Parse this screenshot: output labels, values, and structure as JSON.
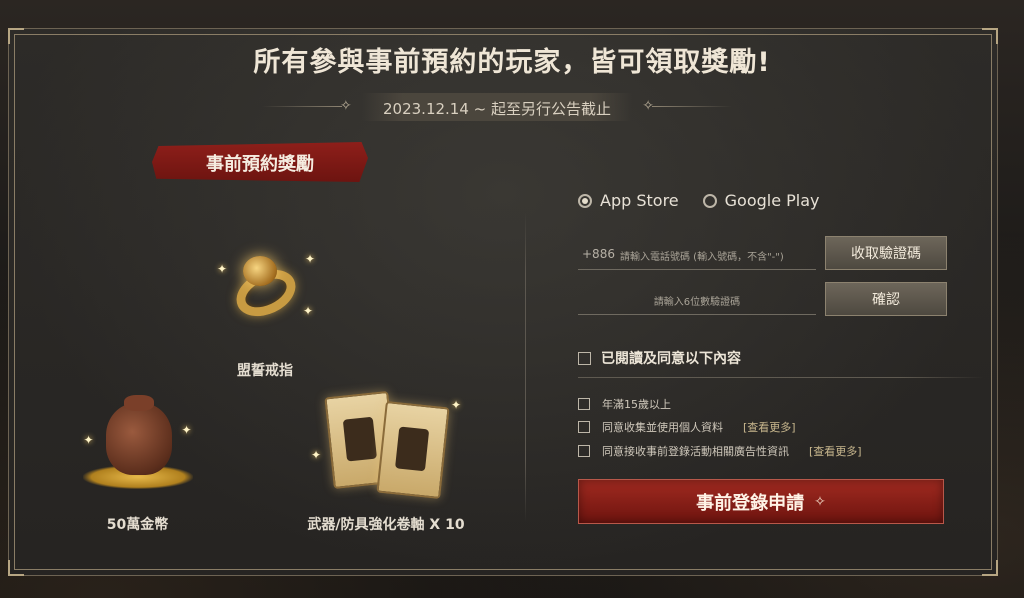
{
  "headline": "所有參與事前預約的玩家，皆可領取獎勵!",
  "period": "2023.12.14 ~ 起至另行公告截止",
  "rewards_title": "事前預約獎勵",
  "rewards": [
    {
      "name": "盟誓戒指",
      "icon": "ring-icon"
    },
    {
      "name": "50萬金幣",
      "icon": "gold-bag-icon"
    },
    {
      "name": "武器/防具強化卷軸 X 10",
      "icon": "scroll-icon"
    }
  ],
  "platforms": {
    "selected": "App Store",
    "options": [
      "App Store",
      "Google Play"
    ]
  },
  "phone": {
    "prefix": "+886",
    "placeholder": "請輸入電話號碼 (輸入號碼，不含\"-\")"
  },
  "send_code_label": "收取驗證碼",
  "code": {
    "placeholder": "請輸入6位數驗證碼"
  },
  "confirm_label": "確認",
  "agree_all": "已閱讀及同意以下內容",
  "agreements": [
    {
      "text": "年滿15歲以上",
      "more": ""
    },
    {
      "text": "同意收集並使用個人資料",
      "more": "[查看更多]"
    },
    {
      "text": "同意接收事前登錄活動相關廣告性資訊",
      "more": "[查看更多]"
    }
  ],
  "submit_label": "事前登錄申請",
  "colors": {
    "accent_red": "#8e1f1a",
    "button_gray": "#5d574c",
    "frame_gold": "#8a7d66"
  }
}
